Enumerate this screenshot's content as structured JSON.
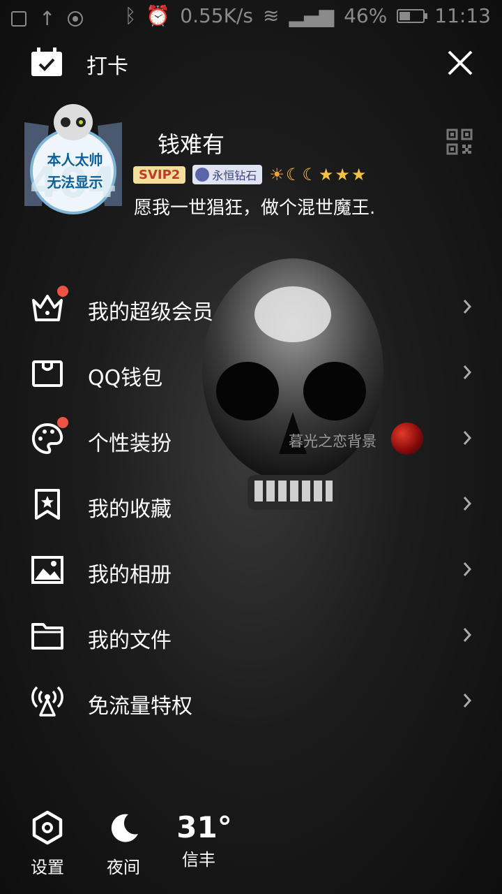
{
  "statusbar": {
    "speed": "0.55K/s",
    "battery": "46%",
    "battery_level": 0.46,
    "time": "11:13"
  },
  "header": {
    "checkin_label": "打卡"
  },
  "profile": {
    "avatar_text_line1": "本人太帅",
    "avatar_text_line2": "无法显示",
    "avatar_watermark": "404",
    "nickname": "钱难有",
    "svip_badge": "SVIP2",
    "diamond_badge": "永恒钻石",
    "level_icons": "☀☾☾★★★",
    "signature": "愿我一世猖狂，做个混世魔王."
  },
  "menu": {
    "items": [
      {
        "label": "我的超级会员",
        "icon": "crown-icon"
      },
      {
        "label": "QQ钱包",
        "icon": "wallet-icon"
      },
      {
        "label": "个性装扮",
        "icon": "palette-icon",
        "detail": "暮光之恋背景"
      },
      {
        "label": "我的收藏",
        "icon": "bookmark-icon"
      },
      {
        "label": "我的相册",
        "icon": "photo-icon"
      },
      {
        "label": "我的文件",
        "icon": "folder-icon"
      },
      {
        "label": "免流量特权",
        "icon": "antenna-icon"
      }
    ]
  },
  "bottom": {
    "settings_label": "设置",
    "night_label": "夜间",
    "temperature": "31°",
    "city": "信丰"
  },
  "colors": {
    "badge_dot": "#ef5442",
    "svip_bg": "#f4df9a",
    "svip_text": "#c0392b"
  }
}
